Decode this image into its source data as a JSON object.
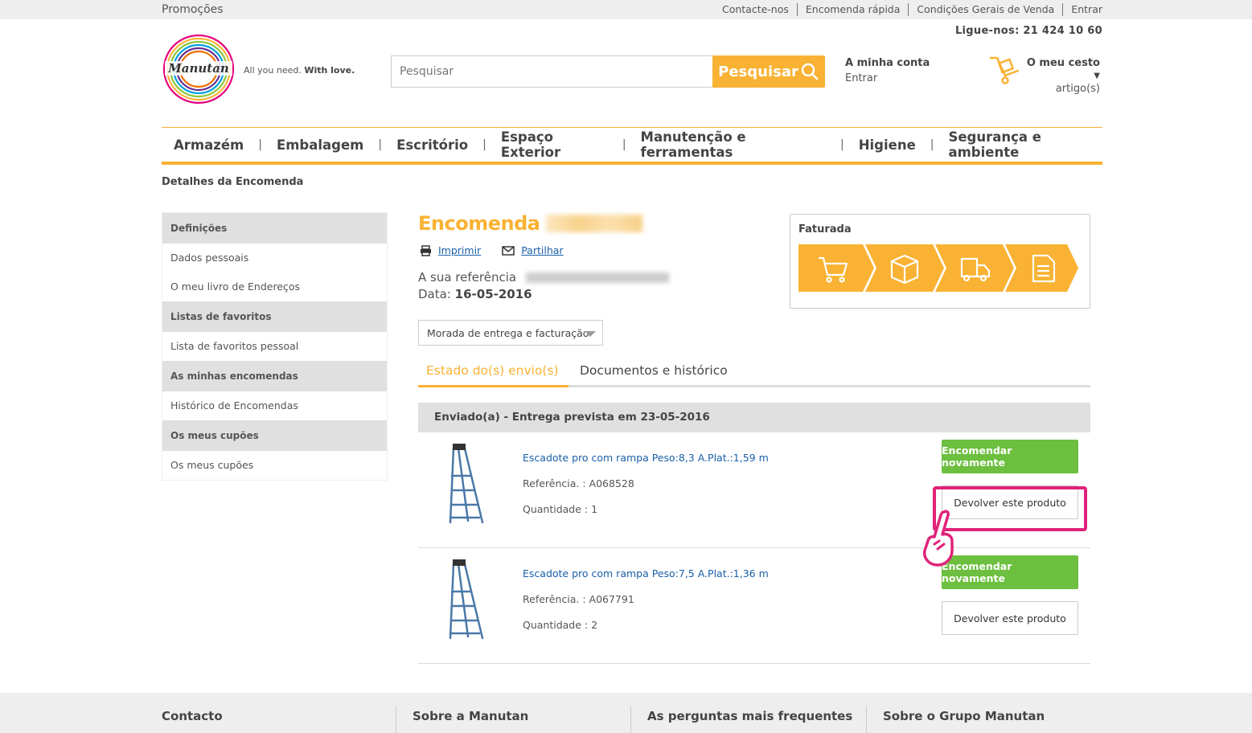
{
  "topbar": {
    "promo": "Promoções",
    "links": [
      "Contacte-nos",
      "Encomenda rápida",
      "Condições Gerais de Venda",
      "Entrar"
    ]
  },
  "header": {
    "phone": "Ligue-nos: 21 424 10 60",
    "logo_text": "Manutan",
    "tagline_light": "All you need.",
    "tagline_bold": "With love.",
    "search_placeholder": "Pesquisar",
    "search_button": "Pesquisar",
    "account_title": "A minha conta",
    "account_sub": "Entrar",
    "cart_title": "O meu cesto",
    "cart_sub": "artigo(s)"
  },
  "nav": [
    "Armazém",
    "Embalagem",
    "Escritório",
    "Espaço Exterior",
    "Manutenção e ferramentas",
    "Higiene",
    "Segurança e ambiente"
  ],
  "breadcrumb": "Detalhes da Encomenda",
  "sidebar": {
    "sections": [
      {
        "title": "Definições",
        "links": [
          "Dados pessoais",
          "O meu livro de Endereços"
        ]
      },
      {
        "title": "Listas de favoritos",
        "links": [
          "Lista de favoritos pessoal"
        ]
      },
      {
        "title": "As minhas encomendas",
        "links": [
          "Histórico de Encomendas"
        ]
      },
      {
        "title": "Os meus cupões",
        "links": [
          "Os meus cupões"
        ]
      }
    ]
  },
  "order": {
    "title": "Encomenda",
    "print": "Imprimir",
    "share": "Partilhar",
    "ref_label": "A sua referência",
    "date_label": "Data:",
    "date_value": "16-05-2016",
    "address_select": "Morada de entrega e facturação",
    "status_label": "Faturada"
  },
  "tabs": [
    "Estado do(s) envio(s)",
    "Documentos e histórico"
  ],
  "shipment": {
    "title": "Enviado(a) - Entrega prevista em 23-05-2016",
    "products": [
      {
        "name": "Escadote pro com rampa Peso:8,3 A.Plat.:1,59 m",
        "ref": "Referência. : A068528",
        "qty": "Quantidade : 1",
        "reorder": "Encomendar novamente",
        "return": "Devolver este produto"
      },
      {
        "name": "Escadote pro com rampa Peso:7,5 A.Plat.:1,36 m",
        "ref": "Referência. : A067791",
        "qty": "Quantidade : 2",
        "reorder": "Encomendar novamente",
        "return": "Devolver este produto"
      }
    ]
  },
  "footer": {
    "columns": [
      "Contacto",
      "Sobre a Manutan",
      "As perguntas mais frequentes",
      "Sobre o Grupo Manutan"
    ]
  },
  "colors": {
    "brand_orange": "#f9b233",
    "green": "#6cbf3f",
    "link_blue": "#1a5fa8",
    "highlight_pink": "#e0237a"
  }
}
